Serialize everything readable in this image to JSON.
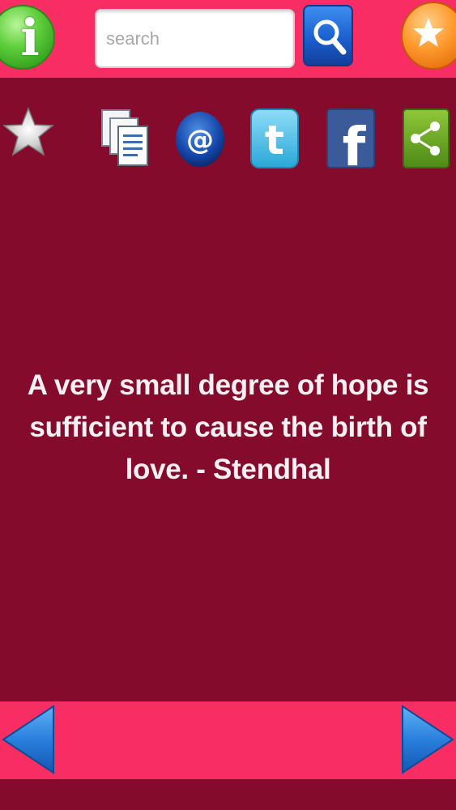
{
  "header": {
    "info_icon": "info-icon",
    "search": {
      "placeholder": "search",
      "value": ""
    },
    "search_icon": "magnifier-icon",
    "favorites_icon": "star-icon"
  },
  "share_bar": {
    "icons": [
      "favorite-star-icon",
      "copy-icon",
      "email-icon",
      "twitter-icon",
      "facebook-icon",
      "share-icon"
    ]
  },
  "quote": {
    "text": "A very small degree of hope is sufficient to cause the birth of love. - Stendhal"
  },
  "footer": {
    "prev_icon": "arrow-left-icon",
    "next_icon": "arrow-right-icon"
  },
  "colors": {
    "bar": "#f72d63",
    "background": "#850b2c",
    "text": "#f8f0f2"
  }
}
